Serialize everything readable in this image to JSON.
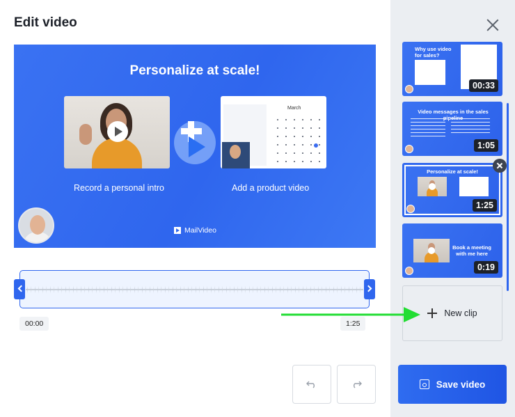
{
  "dialog": {
    "title": "Edit video"
  },
  "preview": {
    "heading": "Personalize at scale!",
    "intro_caption": "Record a personal intro",
    "product_caption": "Add a product video",
    "brand": "MailVideo",
    "calendar_month": "March"
  },
  "timeline": {
    "start_time": "00:00",
    "end_time": "1:25"
  },
  "controls": {
    "undo_icon": "undo-icon",
    "redo_icon": "redo-icon"
  },
  "sidebar": {
    "clips": [
      {
        "title": "Why use video for sales?",
        "duration": "00:33"
      },
      {
        "title": "Video messages in the sales pipeline",
        "duration": "1:05"
      },
      {
        "title": "Personalize at scale!",
        "duration": "1:25",
        "selected": true
      },
      {
        "title": "Book a meeting with me here",
        "duration": "0:19"
      }
    ],
    "new_clip_label": "New clip",
    "save_label": "Save video"
  },
  "colors": {
    "accent": "#2f66ee",
    "arrow": "#22dd33",
    "sidebar_bg": "#ebeef2"
  }
}
